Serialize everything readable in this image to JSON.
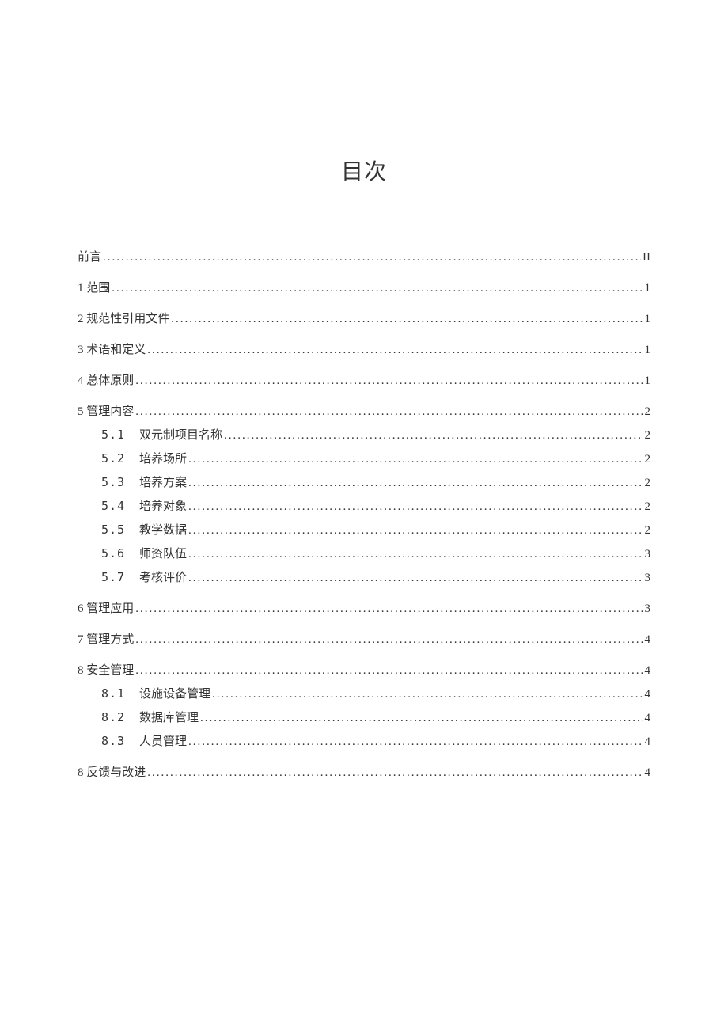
{
  "title": "目次",
  "entries": [
    {
      "label": "前言",
      "page": "II",
      "level": 1
    },
    {
      "label": "1 范围",
      "page": "1",
      "level": 1
    },
    {
      "label": "2 规范性引用文件",
      "page": "1",
      "level": 1
    },
    {
      "label": "3 术语和定义",
      "page": "1",
      "level": 1
    },
    {
      "label": "4 总体原则",
      "page": "1",
      "level": 1
    }
  ],
  "section5": {
    "head": {
      "label": "5 管理内容",
      "page": "2",
      "level": 1
    },
    "children": [
      {
        "num": "5.1",
        "label": "双元制项目名称",
        "page": "2",
        "level": 2
      },
      {
        "num": "5.2",
        "label": "培养场所",
        "page": "2",
        "level": 2
      },
      {
        "num": "5.3",
        "label": "培养方案",
        "page": "2",
        "level": 2
      },
      {
        "num": "5.4",
        "label": "培养对象",
        "page": "2",
        "level": 2
      },
      {
        "num": "5.5",
        "label": "教学数据",
        "page": "2",
        "level": 2
      },
      {
        "num": "5.6",
        "label": "师资队伍",
        "page": "3",
        "level": 2
      },
      {
        "num": "5.7",
        "label": "考核评价",
        "page": "3",
        "level": 2
      }
    ]
  },
  "entries2": [
    {
      "label": "6 管理应用",
      "page": "3",
      "level": 1
    },
    {
      "label": "7 管理方式",
      "page": "4",
      "level": 1
    }
  ],
  "section8": {
    "head": {
      "label": "8 安全管理",
      "page": "4",
      "level": 1
    },
    "children": [
      {
        "num": "8.1",
        "label": "设施设备管理",
        "page": "4",
        "level": 2
      },
      {
        "num": "8.2",
        "label": "数据库管理",
        "page": "4",
        "level": 2
      },
      {
        "num": "8.3",
        "label": "人员管理",
        "page": "4",
        "level": 2
      }
    ]
  },
  "entries3": [
    {
      "label": "8 反馈与改进",
      "page": "4",
      "level": 1
    }
  ]
}
